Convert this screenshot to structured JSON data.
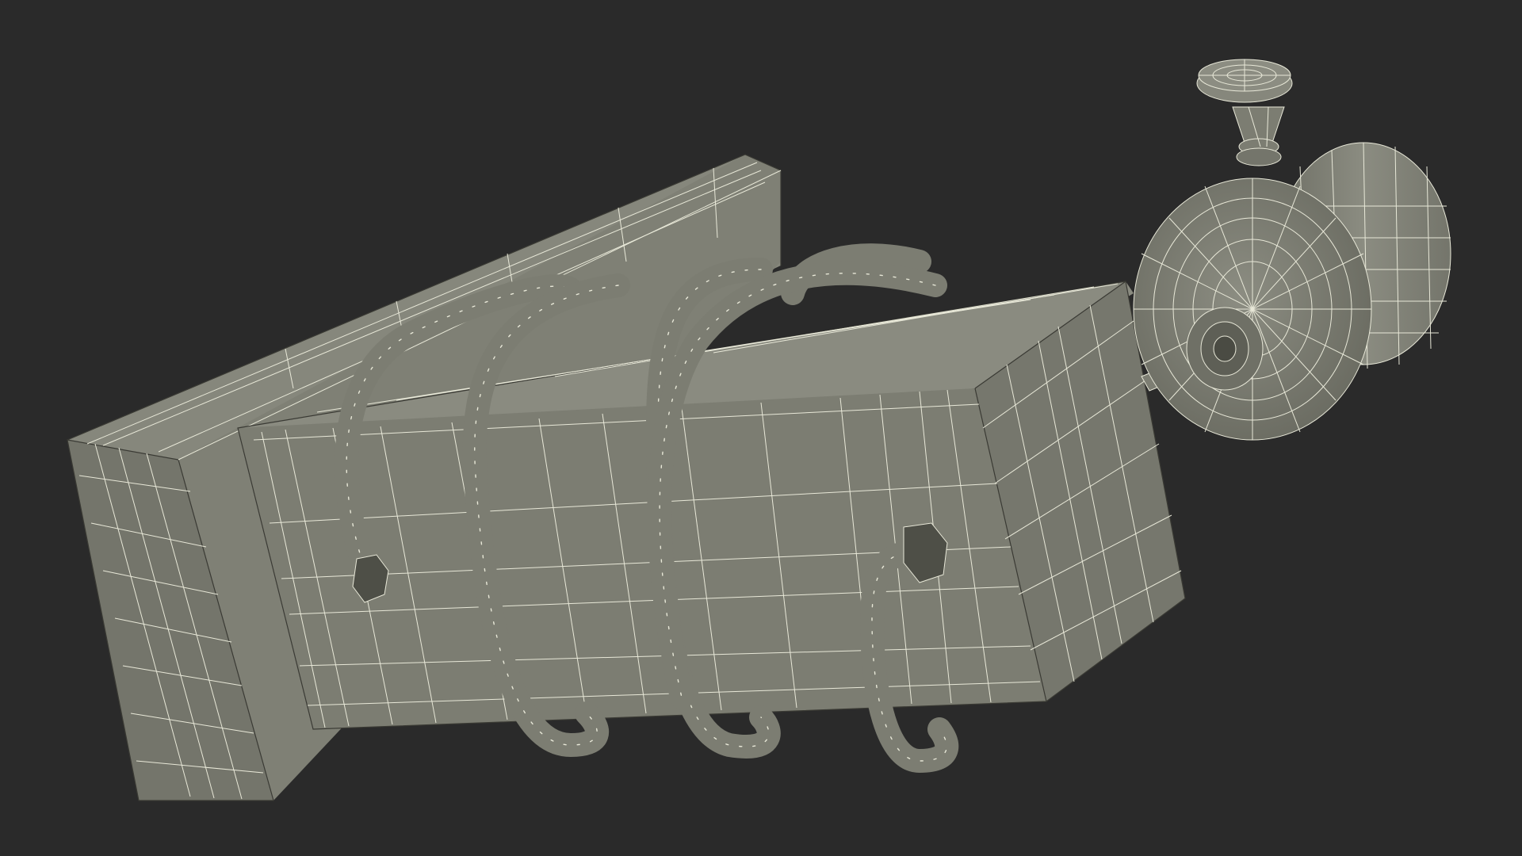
{
  "scene": {
    "subject": "wireframe-3d-model",
    "colors": {
      "background": "#2a2a2a",
      "surface": "#7c7d72",
      "surface_dark": "#67685e",
      "surface_light": "#8a8b80",
      "wire": "#e8e8d8"
    }
  }
}
